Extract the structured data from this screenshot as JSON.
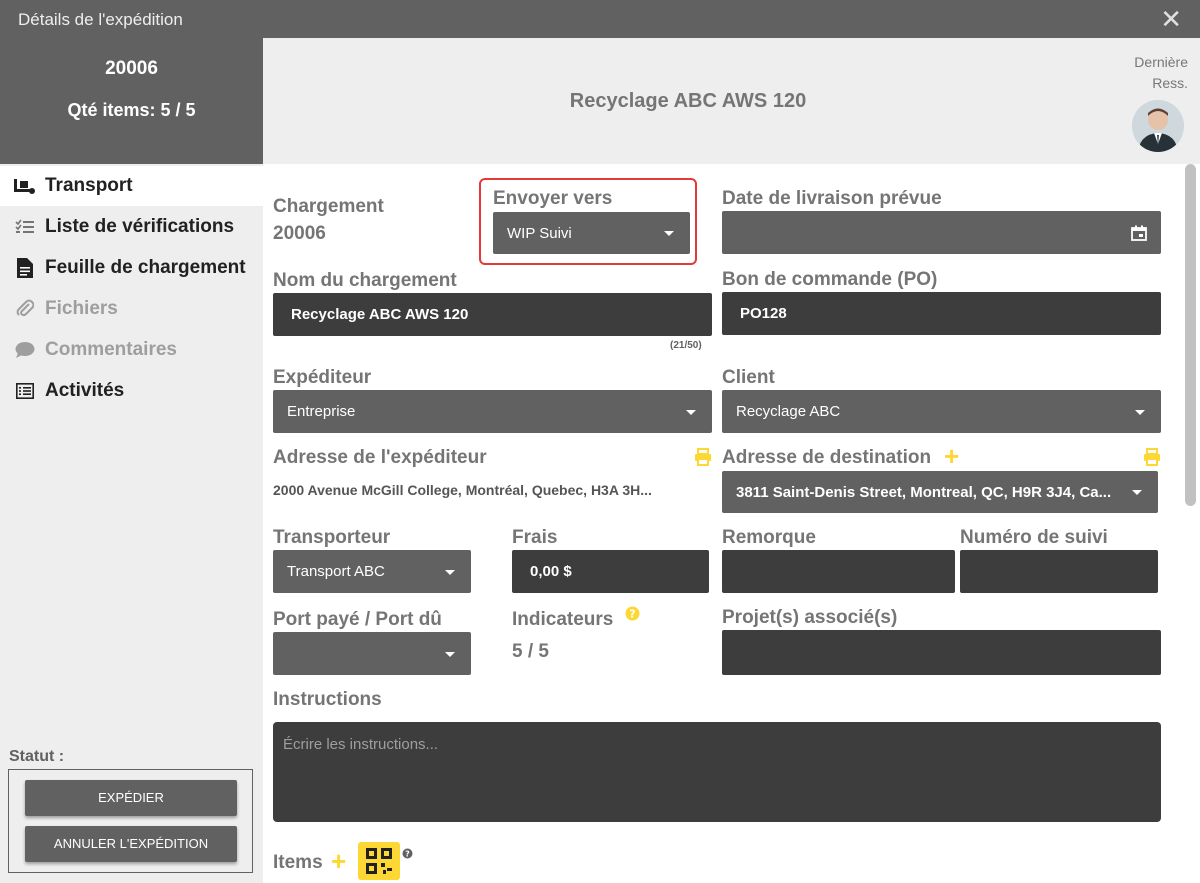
{
  "window": {
    "title": "Détails de l'expédition"
  },
  "summary": {
    "number": "20006",
    "qty": "Qté items: 5 / 5"
  },
  "header": {
    "name": "Recyclage ABC AWS 120",
    "last_resource": "Dernière Ress."
  },
  "nav": {
    "items": [
      {
        "label": "Transport",
        "icon": "truck-loading-icon"
      },
      {
        "label": "Liste de vérifications",
        "icon": "checklist-icon"
      },
      {
        "label": "Feuille de chargement",
        "icon": "document-icon"
      },
      {
        "label": "Fichiers",
        "icon": "paperclip-icon"
      },
      {
        "label": "Commentaires",
        "icon": "comment-icon"
      },
      {
        "label": "Activités",
        "icon": "list-icon"
      }
    ]
  },
  "status": {
    "label": "Statut :",
    "ship_button": "EXPÉDIER",
    "cancel_button": "ANNULER L'EXPÉDITION"
  },
  "form": {
    "chargement_label": "Chargement",
    "chargement_value": "20006",
    "envoyer_label": "Envoyer vers",
    "envoyer_value": "WIP Suivi",
    "date_label": "Date de livraison prévue",
    "date_value": "",
    "nom_label": "Nom du chargement",
    "nom_value": "Recyclage ABC AWS 120",
    "nom_counter": "(21/50)",
    "po_label": "Bon de commande (PO)",
    "po_value": "PO128",
    "expediteur_label": "Expéditeur",
    "expediteur_value": "Entreprise",
    "client_label": "Client",
    "client_value": "Recyclage ABC",
    "adresse_exp_label": "Adresse de l'expéditeur",
    "adresse_exp_value": "2000 Avenue McGill College, Montréal, Quebec, H3A 3H...",
    "adresse_dest_label": "Adresse de destination",
    "adresse_dest_value": "3811 Saint-Denis Street, Montreal, QC, H9R 3J4, Ca...",
    "transporteur_label": "Transporteur",
    "transporteur_value": "Transport ABC",
    "frais_label": "Frais",
    "frais_value": "0,00 $",
    "remorque_label": "Remorque",
    "remorque_value": "",
    "suivi_label": "Numéro de suivi",
    "suivi_value": "",
    "port_label": "Port payé / Port dû",
    "port_value": "",
    "indicateurs_label": "Indicateurs",
    "indicateurs_value": "5 / 5",
    "projets_label": "Projet(s) associé(s)",
    "projets_value": "",
    "instructions_label": "Instructions",
    "instructions_placeholder": "Écrire les instructions...",
    "items_label": "Items"
  },
  "colors": {
    "accent_yellow": "#fdd835",
    "highlight_red": "#e53935",
    "dark": "#3d3d3d",
    "mid": "#616161"
  }
}
